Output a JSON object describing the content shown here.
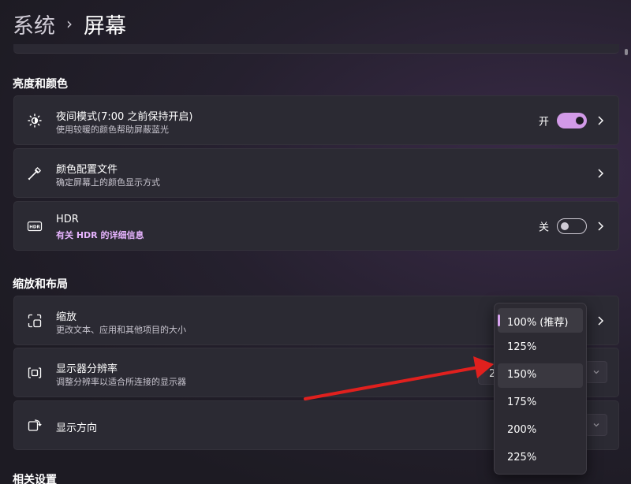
{
  "breadcrumb": {
    "parent": "系统",
    "separator": "›",
    "current": "屏幕"
  },
  "sections": {
    "brightness_color": "亮度和颜色",
    "scale_layout": "缩放和布局",
    "related": "相关设置"
  },
  "night_light": {
    "title": "夜间模式(7:00 之前保持开启)",
    "subtitle": "使用较暖的颜色帮助屏蔽蓝光",
    "state_label": "开",
    "enabled": true
  },
  "color_profile": {
    "title": "颜色配置文件",
    "subtitle": "确定屏幕上的颜色显示方式"
  },
  "hdr": {
    "title": "HDR",
    "link": "有关 HDR 的详细信息",
    "state_label": "关",
    "enabled": false,
    "icon_text": "HDR"
  },
  "scale": {
    "title": "缩放",
    "subtitle": "更改文本、应用和其他项目的大小"
  },
  "resolution": {
    "title": "显示器分辨率",
    "subtitle": "调整分辨率以适合所连接的显示器",
    "value_partial": "2"
  },
  "orientation": {
    "title": "显示方向"
  },
  "scale_dropdown": {
    "options": [
      "100% (推荐)",
      "125%",
      "150%",
      "175%",
      "200%",
      "225%"
    ],
    "selected_index": 0,
    "hover_index": 2
  },
  "colors": {
    "accent": "#d29ae8",
    "link": "#e7b4ff",
    "annotation_arrow": "#e0201e"
  }
}
